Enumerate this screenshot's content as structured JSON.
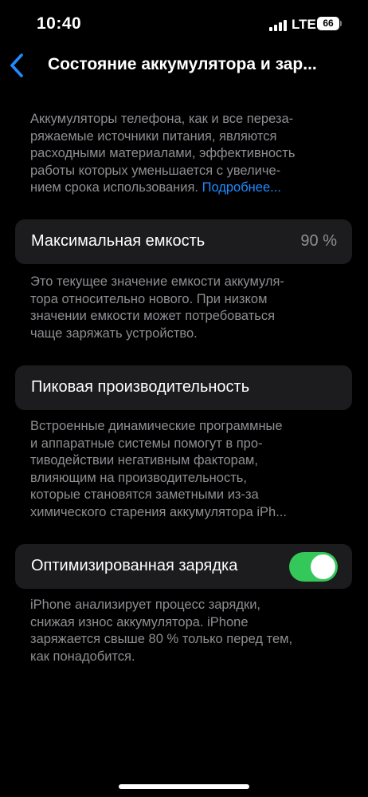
{
  "status_bar": {
    "time": "10:40",
    "network": "LTE",
    "battery_level": "66"
  },
  "nav": {
    "back_icon": "chevron-left-icon",
    "title": "Состояние аккумулятора и зар..."
  },
  "intro": {
    "lines": [
      "Аккумуляторы телефона, как и все переза-",
      "ряжаемые источники питания, являются",
      "расходными материалами, эффективность",
      "работы которых уменьшается с увеличе-"
    ],
    "last_line": "нием срока использования.",
    "link": "Подробнее..."
  },
  "max_capacity": {
    "label": "Максимальная емкость",
    "value": "90 %",
    "footer": [
      "Это текущее значение емкости аккумуля-",
      "тора относительно нового. При низком",
      "значении емкости может потребоваться",
      "чаще заряжать устройство."
    ]
  },
  "peak_performance": {
    "label": "Пиковая производительность",
    "footer": [
      "Встроенные динамические программные",
      "и аппаратные системы помогут в про-",
      "тиводействии негативным факторам,",
      "влияющим на производительность,",
      "которые становятся заметными из-за",
      "химического старения аккумулятора iPh..."
    ]
  },
  "optimized_charging": {
    "label": "Оптимизированная зарядка",
    "enabled": true,
    "accent": "#34c759",
    "footer": [
      "iPhone анализирует процесс зарядки,",
      "снижая износ аккумулятора. iPhone",
      "заряжается свыше 80 % только перед тем,",
      "как понадобится."
    ]
  },
  "colors": {
    "background": "#000000",
    "cell": "#1c1c1e",
    "link": "#1f8bff",
    "secondary_text": "#8e8e93"
  }
}
